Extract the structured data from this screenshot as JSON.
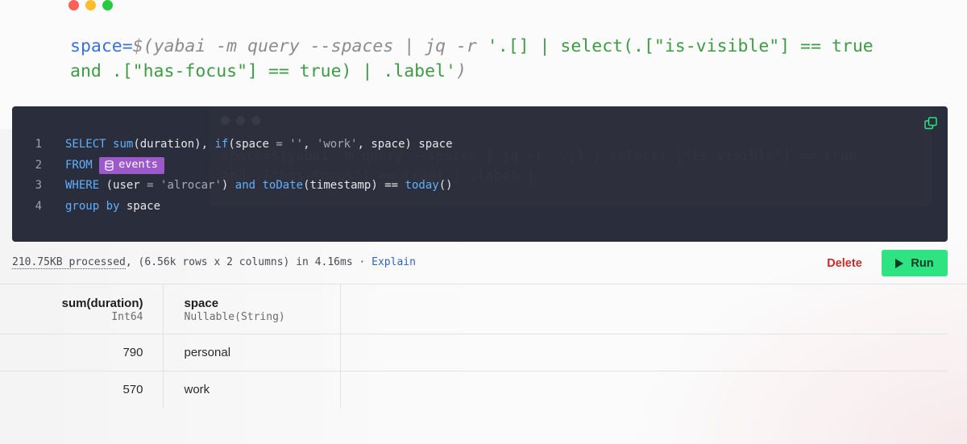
{
  "shell": {
    "variable": "space",
    "equals": "=",
    "open": "$(",
    "command": "yabai -m query --spaces | jq -r",
    "jq_line1": " '.[] | select(.[\"is-visible\"] == true",
    "jq_line2": "and .[\"has-focus\"] == true) | .label'",
    "close": ")"
  },
  "editor": {
    "ghost_line1": "space=$(yabai -m query --spaces | jq -r '.[] | select(.[\"is-visible\"] == true",
    "ghost_line2": "and .[\"has-focus\"] == true) | .label')",
    "lines": [
      {
        "n": "1"
      },
      {
        "n": "2",
        "kw": "FROM",
        "table": "events"
      },
      {
        "n": "3"
      },
      {
        "n": "4"
      }
    ],
    "line1": {
      "kw": "SELECT",
      "fn1": "sum",
      "arg1": "(duration), ",
      "fn2": "if",
      "p1": "(space ",
      "eq": "=",
      "s1": "''",
      "c1": ", ",
      "s2": "'work'",
      "rest": ", space) space"
    },
    "line3": {
      "kw": "WHERE",
      "p1": " (user ",
      "eq": "=",
      "s1": "'alrocar'",
      "p2": ") ",
      "and": "and",
      "sp": " ",
      "fn": "toDate",
      "p3": "(timestamp) ",
      "op": "==",
      "sp2": " ",
      "fn2": "today",
      "p4": "()"
    },
    "line4": {
      "kw": "group by",
      "rest": " space"
    }
  },
  "status": {
    "processed": "210.75KB processed",
    "details": ", (6.56k rows x 2 columns) in 4.16ms · ",
    "explain": "Explain"
  },
  "actions": {
    "delete": "Delete",
    "run": "Run"
  },
  "results": {
    "columns": [
      {
        "name": "sum(duration)",
        "type": "Int64"
      },
      {
        "name": "space",
        "type": "Nullable(String)"
      }
    ],
    "rows": [
      [
        "790",
        "personal"
      ],
      [
        "570",
        "work"
      ]
    ]
  },
  "colors": {
    "editor_bg": "#2a2d3b",
    "run_bg": "#2ee382",
    "delete": "#cc2a26",
    "tag": "#9b59c9"
  }
}
